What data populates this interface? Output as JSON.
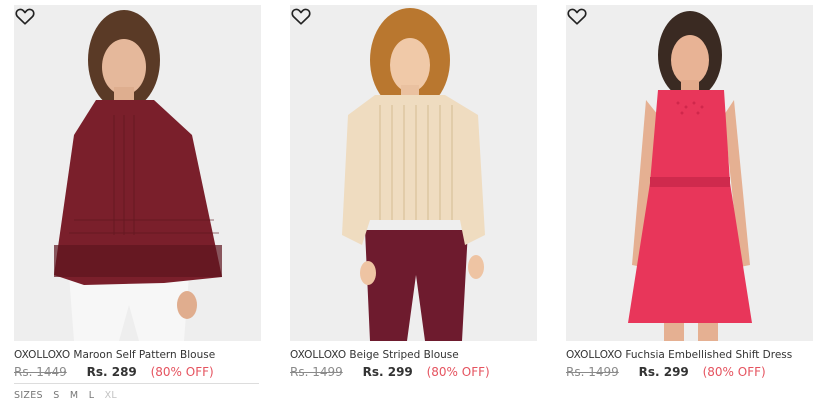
{
  "products": [
    {
      "name": "OXOLLOXO Maroon Self Pattern Blouse",
      "original_price": "Rs. 1449",
      "price": "Rs. 289",
      "discount": "(80% OFF)",
      "image_alt": "maroon-blouse-model",
      "garment_color": "#7a1f2b",
      "sizes_label": "SIZES",
      "sizes": [
        "S",
        "M",
        "L",
        "XL"
      ]
    },
    {
      "name": "OXOLLOXO Beige Striped Blouse",
      "original_price": "Rs. 1499",
      "price": "Rs. 299",
      "discount": "(80% OFF)",
      "image_alt": "beige-blouse-model",
      "garment_color": "#efdcc0"
    },
    {
      "name": "OXOLLOXO Fuchsia Embellished Shift Dress",
      "original_price": "Rs. 1499",
      "price": "Rs. 299",
      "discount": "(80% OFF)",
      "image_alt": "fuchsia-dress-model",
      "garment_color": "#e8365a"
    }
  ],
  "colors": {
    "discount": "#e5535f",
    "strike_price": "#8a8a8a",
    "image_background": "#eeeeee"
  },
  "icons": {
    "wishlist": "heart-outline-icon"
  }
}
